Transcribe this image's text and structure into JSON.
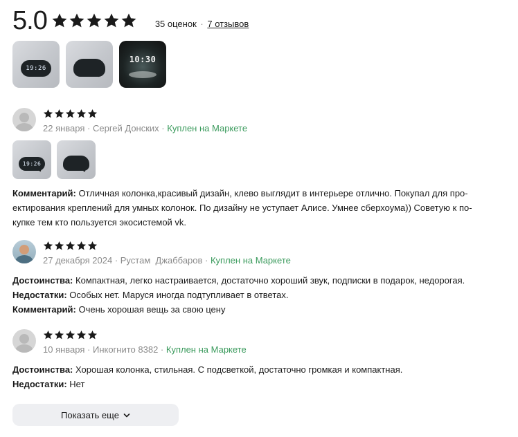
{
  "summary": {
    "rating": "5.0",
    "stars": 5,
    "ratings_count": "35 оценок",
    "separator": "·",
    "reviews_link": "7 отзывов"
  },
  "top_photos": [
    {
      "kind": "light",
      "clock": "19:26"
    },
    {
      "kind": "light",
      "clock": ""
    },
    {
      "kind": "dark",
      "clock": "10:30"
    }
  ],
  "reviews": [
    {
      "stars": 5,
      "avatar": "placeholder",
      "date": "22 января",
      "author": "Сергей Донских",
      "verified": "Куплен на Маркете",
      "photos": [
        {
          "clock": "19:26"
        },
        {
          "clock": ""
        }
      ],
      "comment_label": "Комментарий:",
      "comment": "Отличная колонка,красивый дизайн, клево выглядит в интерьере отлично. Покупал для про-",
      "comment_line2": "ектирования креплений для умных колонок. По дизайну не уступает Алисе. Умнее сберхоума)) Советую к по-",
      "comment_line3": "купке тем кто пользуется экосистемой vk."
    },
    {
      "stars": 5,
      "avatar": "photo",
      "date": "27 декабря 2024",
      "author": "Рустам  Джаббаров",
      "verified": "Куплен на Маркете",
      "pros_label": "Достоинства:",
      "pros": "Компактная, легко настраивается, достаточно хороший звук, подписки в подарок, недорогая.",
      "cons_label": "Недостатки:",
      "cons": "Особых нет. Маруся иногда подтупливает в ответах.",
      "comment_label": "Комментарий:",
      "comment": "Очень хорошая вещь за свою цену"
    },
    {
      "stars": 5,
      "avatar": "placeholder",
      "date": "10 января",
      "author": "Инкогнито 8382",
      "verified": "Куплен на Маркете",
      "pros_label": "Достоинства:",
      "pros": "Хорошая колонка, стильная. С подсветкой, достаточно громкая и компактная.",
      "cons_label": "Недостатки:",
      "cons": "Нет"
    }
  ],
  "show_more_label": "Показать еще",
  "colors": {
    "verified": "#3a9a5c",
    "meta": "#8a8a8a",
    "button_bg": "#eeeff2"
  }
}
